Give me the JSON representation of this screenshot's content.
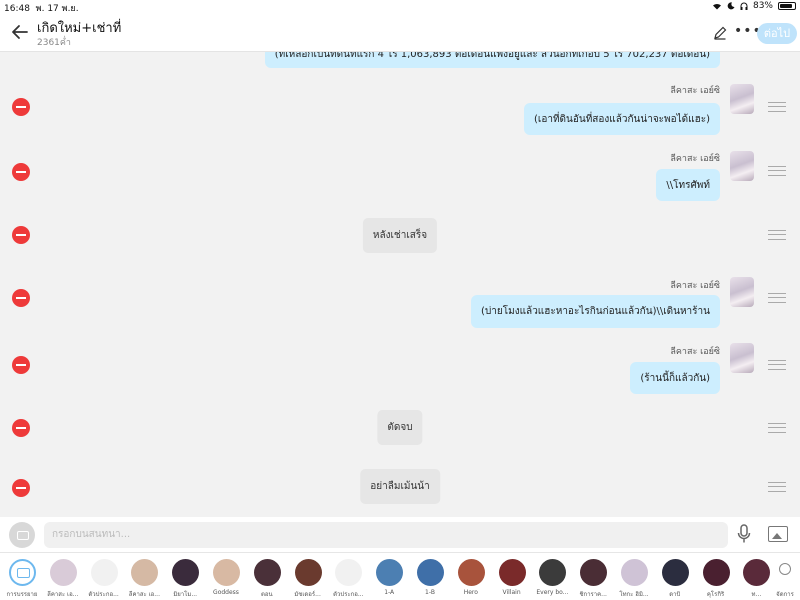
{
  "status_bar": {
    "time": "16:48",
    "date": "พ. 17 พ.ย.",
    "battery": "83%",
    "battery_level": 0.83
  },
  "header": {
    "title": "เกิดใหม่+เช่าที่",
    "subtitle": "2361ค่ำ",
    "next_label": "ต่อไป"
  },
  "partial_message": "(ที่เหลือก็เป็นที่ดินที่แรก 4 ไร่ 1,063,893 ตอเดือนแพงอยู่และ ส่วนอีกที่เกือบ 5 ไร่ 702,237 ต่อเดือน)",
  "messages": [
    {
      "type": "character",
      "sender": "ลีคาสะ เอย์ซิ",
      "text": "(เอาที่ดินอันที่สองแล้วกันน่าจะพอได้แฮะ)"
    },
    {
      "type": "character",
      "sender": "ลีคาสะ เอย์ซิ",
      "text": "\\\\โทรศัพท์"
    },
    {
      "type": "narration",
      "text": "หลังเช่าเสร็จ"
    },
    {
      "type": "character",
      "sender": "ลีคาสะ เอย์ซิ",
      "text": "(บ่ายโมงแล้วแฮะหาอะไรกินก่อนแล้วกัน)\\\\เดินหาร้าน"
    },
    {
      "type": "character",
      "sender": "ลีคาสะ เอย์ซิ",
      "text": "(ร้านนี้ก็แล้วกัน)"
    },
    {
      "type": "narration",
      "text": "ตัดจบ"
    },
    {
      "type": "narration",
      "text": "อย่าลืมเม้นน้า"
    }
  ],
  "input": {
    "placeholder": "กรอกบนสนทนา..."
  },
  "characters": [
    {
      "name": "การบรรยาย",
      "color": "#ffffff"
    },
    {
      "name": "ลีคาสะ เอ...",
      "color": "#d9cbd8"
    },
    {
      "name": "ตัวประกอ...",
      "color": "#f1f1f1"
    },
    {
      "name": "ลีคาสะ เอ...",
      "color": "#d5b9a4"
    },
    {
      "name": "มิยาโม...",
      "color": "#3a2b3c"
    },
    {
      "name": "Goddess",
      "color": "#d8b9a3"
    },
    {
      "name": "ตอน",
      "color": "#4a3039"
    },
    {
      "name": "มัชเดอร์...",
      "color": "#6a3a2e"
    },
    {
      "name": "ตัวประกอ...",
      "color": "#f1f1f1"
    },
    {
      "name": "1-A",
      "color": "#4c7fb2"
    },
    {
      "name": "1-B",
      "color": "#3f6fa8"
    },
    {
      "name": "Hero",
      "color": "#a8533c"
    },
    {
      "name": "Villain",
      "color": "#7a2a2a"
    },
    {
      "name": "Every bo...",
      "color": "#3b3b3b"
    },
    {
      "name": "ชิการาค...",
      "color": "#4a2d35"
    },
    {
      "name": "โทกะ ฮิมิ...",
      "color": "#cfc3d6"
    },
    {
      "name": "ดาบิ",
      "color": "#2b2d3f"
    },
    {
      "name": "คุโรกิริ",
      "color": "#4a2030"
    },
    {
      "name": "ท...",
      "color": "#5a2a3a"
    }
  ],
  "manage_label": "จัดการ"
}
